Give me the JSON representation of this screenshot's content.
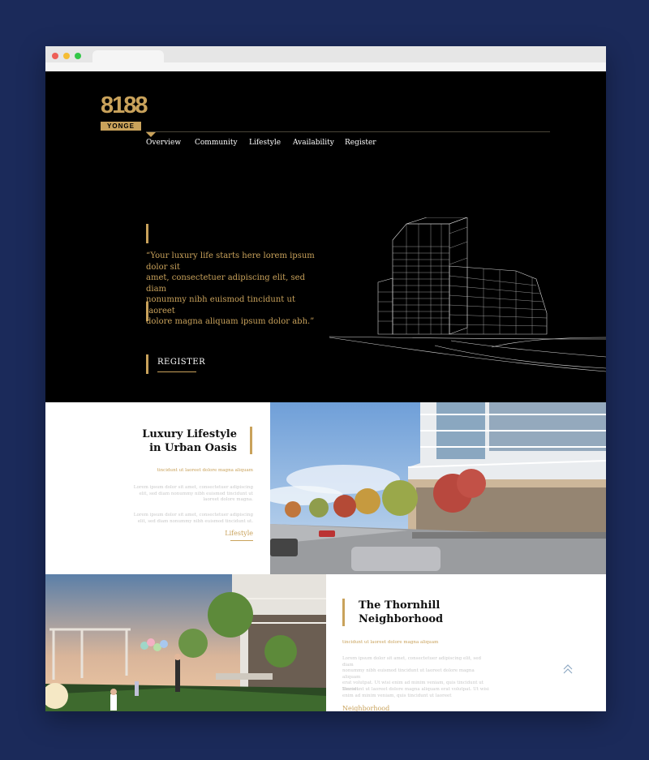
{
  "window": {
    "dots": [
      "red",
      "yellow",
      "green"
    ]
  },
  "brand": {
    "logo_number": "8188",
    "logo_word": "YONGE"
  },
  "nav": {
    "items": [
      {
        "label": "Overview",
        "active": true
      },
      {
        "label": "Community"
      },
      {
        "label": "Lifestyle"
      },
      {
        "label": "Availability"
      },
      {
        "label": "Register"
      }
    ]
  },
  "hero": {
    "quote_lines": [
      "“Your luxury life starts here lorem ipsum dolor sit",
      "amet, consectetuer adipiscing elit, sed diam",
      "nonummy nibh euismod tincidunt ut laoreet",
      "dolore magna aliquam ipsum dolor abh.”"
    ],
    "register_label": "REGISTER"
  },
  "lifestyle": {
    "title_line1": "Luxury Lifestyle",
    "title_line2": "in Urban Oasis",
    "subtitle": "tincidunt ut laoreet dolore magna aliquam",
    "para1": [
      "Lorem ipsum dolor sit amet, consectetuer adipiscing",
      "elit, sed diam nonummy nibh euismod tincidunt ut",
      "laoreet dolore magna."
    ],
    "para2": [
      "Lorem ipsum dolor sit amet, consectetuer adipiscing",
      "elit, sed diam nonummy nibh euismod tincidunt ut."
    ],
    "link": "Lifestyle"
  },
  "neighborhood": {
    "title_line1": "The Thornhill",
    "title_line2": "Neighborhood",
    "subtitle": "tincidunt ut laoreet dolore magna aliquam",
    "para1": [
      "Lorem ipsum dolor sit amet, consectetuer adipiscing elit, sed diam",
      "nonummy nibh euismod tincidunt ut laoreet dolore magna aliquam",
      "erat volutpat. Ut wisi enim ad minim veniam, quis tincidunt ut",
      "laoreet"
    ],
    "para2": [
      "Tincidunt ut laoreet dolore magna aliquam erat volutpat. Ut wisi",
      "enim ad minim veniam, quis tincidunt ut laoreet"
    ],
    "link": "Neighborhood"
  },
  "colors": {
    "accent": "#c9a25b",
    "backdrop": "#1b2a5a"
  },
  "icons": {
    "scroll_top": "double-chevron-up-icon"
  }
}
